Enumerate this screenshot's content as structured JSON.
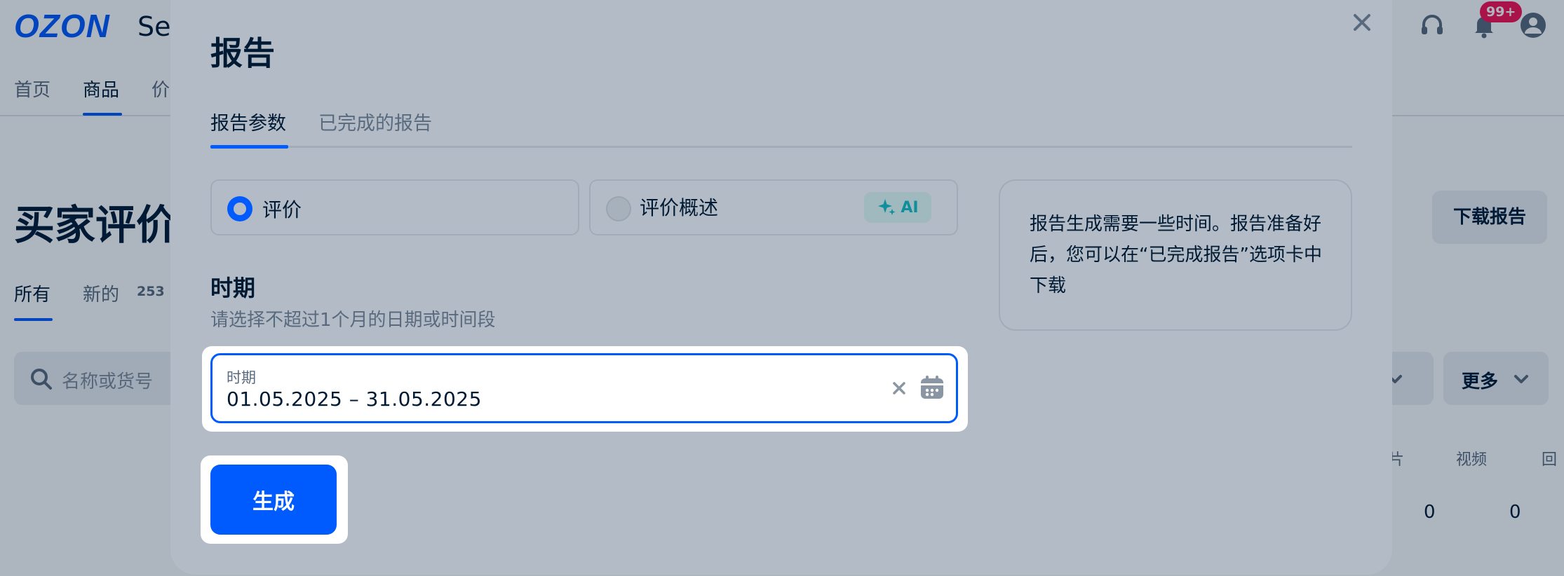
{
  "header": {
    "logo": "OZON",
    "logo_suffix": "Sel",
    "notifications_badge": "99+",
    "icons": [
      "headset-icon",
      "bell-icon",
      "user-icon"
    ]
  },
  "nav": {
    "items": [
      {
        "label": "首页"
      },
      {
        "label": "商品",
        "active": true
      },
      {
        "label": "价"
      }
    ]
  },
  "page": {
    "title": "买家评价",
    "download_button": "下载报告",
    "filter_tabs": [
      {
        "label": "所有",
        "active": true
      },
      {
        "label": "新的",
        "count": "253"
      }
    ],
    "search_placeholder": "名称或货号",
    "more_button": "更多",
    "table": {
      "headers": [
        "片",
        "视频",
        "回"
      ],
      "row_values": [
        "0",
        "0"
      ]
    }
  },
  "modal": {
    "title": "报告",
    "tabs": [
      {
        "label": "报告参数",
        "active": true
      },
      {
        "label": "已完成的报告"
      }
    ],
    "options": [
      {
        "label": "评价",
        "selected": true
      },
      {
        "label": "评价概述",
        "selected": false,
        "chip": "AI"
      }
    ],
    "info_text": "报告生成需要一些时间。报告准备好后，您可以在“已完成报告”选项卡中下载",
    "period": {
      "title": "时期",
      "hint": "请选择不超过1个月的日期或时间段",
      "field_label": "时期",
      "field_value": "01.05.2025 – 31.05.2025"
    },
    "generate_button": "生成"
  },
  "colors": {
    "brand": "#005bff",
    "badge": "#f91155",
    "ai_accent": "#0f8f9c"
  }
}
